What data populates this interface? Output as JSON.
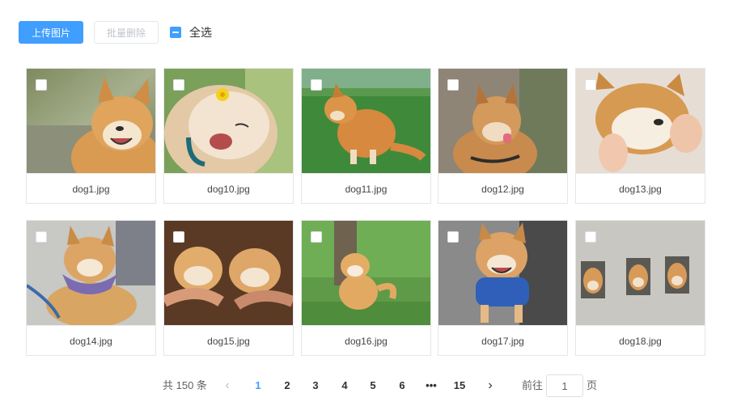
{
  "toolbar": {
    "upload_label": "上传图片",
    "batch_delete_label": "批量删除",
    "select_all_label": "全选"
  },
  "gallery": {
    "items": [
      {
        "filename": "dog1.jpg",
        "checked": false
      },
      {
        "filename": "dog10.jpg",
        "checked": false
      },
      {
        "filename": "dog11.jpg",
        "checked": false
      },
      {
        "filename": "dog12.jpg",
        "checked": false
      },
      {
        "filename": "dog13.jpg",
        "checked": false
      },
      {
        "filename": "dog14.jpg",
        "checked": false
      },
      {
        "filename": "dog15.jpg",
        "checked": false
      },
      {
        "filename": "dog16.jpg",
        "checked": false
      },
      {
        "filename": "dog17.jpg",
        "checked": false
      },
      {
        "filename": "dog18.jpg",
        "checked": false
      }
    ]
  },
  "pagination": {
    "total_text": "共 150 条",
    "pages": [
      "1",
      "2",
      "3",
      "4",
      "5",
      "6",
      "•••",
      "15"
    ],
    "current_page": "1",
    "goto_prefix": "前往",
    "goto_value": "1",
    "goto_suffix": "页",
    "prev_icon": "chevron-left-icon",
    "next_icon": "chevron-right-icon"
  },
  "colors": {
    "primary": "#409eff",
    "disabled_text": "#c0c4cc",
    "border": "#e6e6e6"
  }
}
